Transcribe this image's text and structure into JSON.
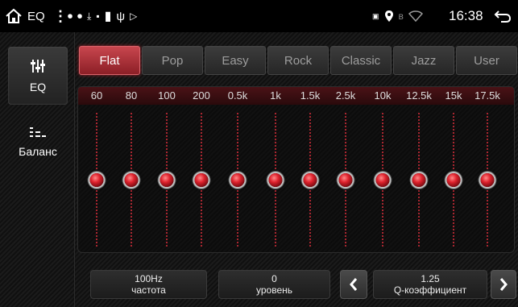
{
  "statusbar": {
    "title": "EQ",
    "time": "16:38",
    "icons": [
      "home-icon",
      "overflow-menu-icon",
      "app-notification-icon",
      "app-notification-icon-2",
      "download-icon",
      "sd-card-icon",
      "storage-icon",
      "usb-icon",
      "play-store-icon",
      "screenshot-icon",
      "location-icon",
      "bluetooth-icon",
      "wifi-icon",
      "back-icon"
    ]
  },
  "sidebar": {
    "items": [
      {
        "label": "EQ",
        "icon": "equalizer-sliders-icon",
        "active": true
      },
      {
        "label": "Баланс",
        "icon": "balance-icon",
        "active": false
      }
    ]
  },
  "presets": [
    "Flat",
    "Pop",
    "Easy",
    "Rock",
    "Classic",
    "Jazz",
    "User"
  ],
  "active_preset": "Flat",
  "bands": [
    "60",
    "80",
    "100",
    "200",
    "0.5k",
    "1k",
    "1.5k",
    "2.5k",
    "10k",
    "12.5k",
    "15k",
    "17.5k"
  ],
  "band_levels": [
    0,
    0,
    0,
    0,
    0,
    0,
    0,
    0,
    0,
    0,
    0,
    0
  ],
  "controls": {
    "frequency": {
      "value": "100Hz",
      "label": "частота"
    },
    "level": {
      "value": "0",
      "label": "уровень"
    },
    "q": {
      "value": "1.25",
      "label": "Q-коэффициент"
    }
  },
  "colors": {
    "accent": "#c8464e",
    "knob": "#e0232e",
    "track": "#a82630"
  }
}
